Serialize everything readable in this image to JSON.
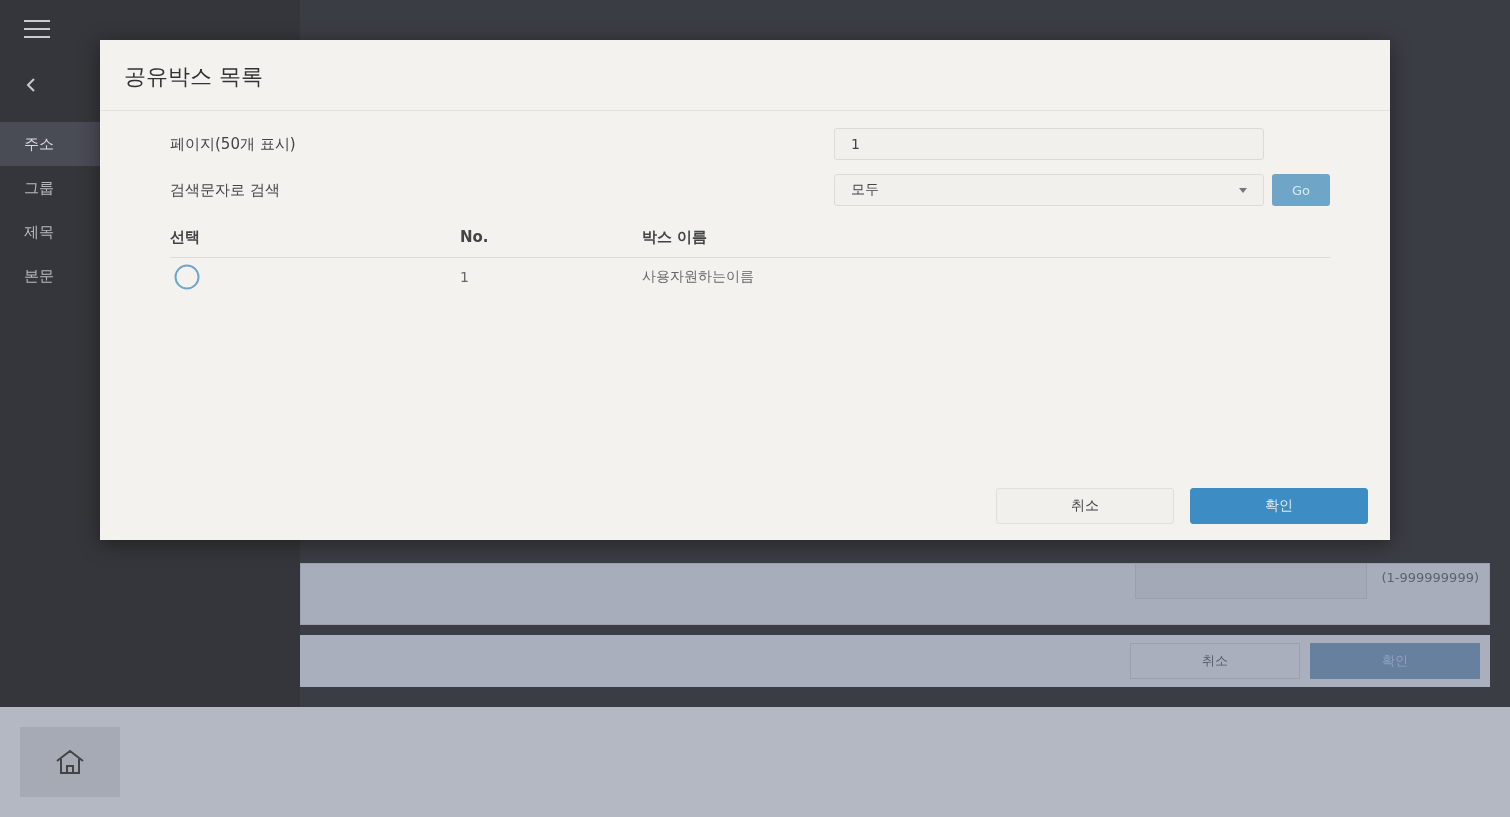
{
  "sidebar": {
    "items": [
      {
        "label": "주소",
        "selected": true
      },
      {
        "label": "그룹",
        "selected": false
      },
      {
        "label": "제목",
        "selected": false
      },
      {
        "label": "본문",
        "selected": false
      }
    ]
  },
  "background_form": {
    "range_hint": "(1-999999999)",
    "buttons": [
      {
        "label": "취소",
        "kind": "secondary"
      },
      {
        "label": "확인",
        "kind": "primary"
      }
    ]
  },
  "dialog": {
    "title": "공유박스 목록",
    "fields": [
      {
        "label": "페이지(50개 표시)",
        "kind": "input",
        "value": "1"
      },
      {
        "label": "검색문자로 검색",
        "kind": "select",
        "value": "모두",
        "button": "Go"
      }
    ],
    "table": {
      "columns": [
        "선택",
        "No.",
        "박스 이름"
      ],
      "rows": [
        {
          "selected": false,
          "no": "1",
          "name": "사용자원하는이름"
        }
      ]
    },
    "buttons": [
      {
        "label": "취소",
        "kind": "secondary"
      },
      {
        "label": "확인",
        "kind": "primary"
      }
    ]
  }
}
